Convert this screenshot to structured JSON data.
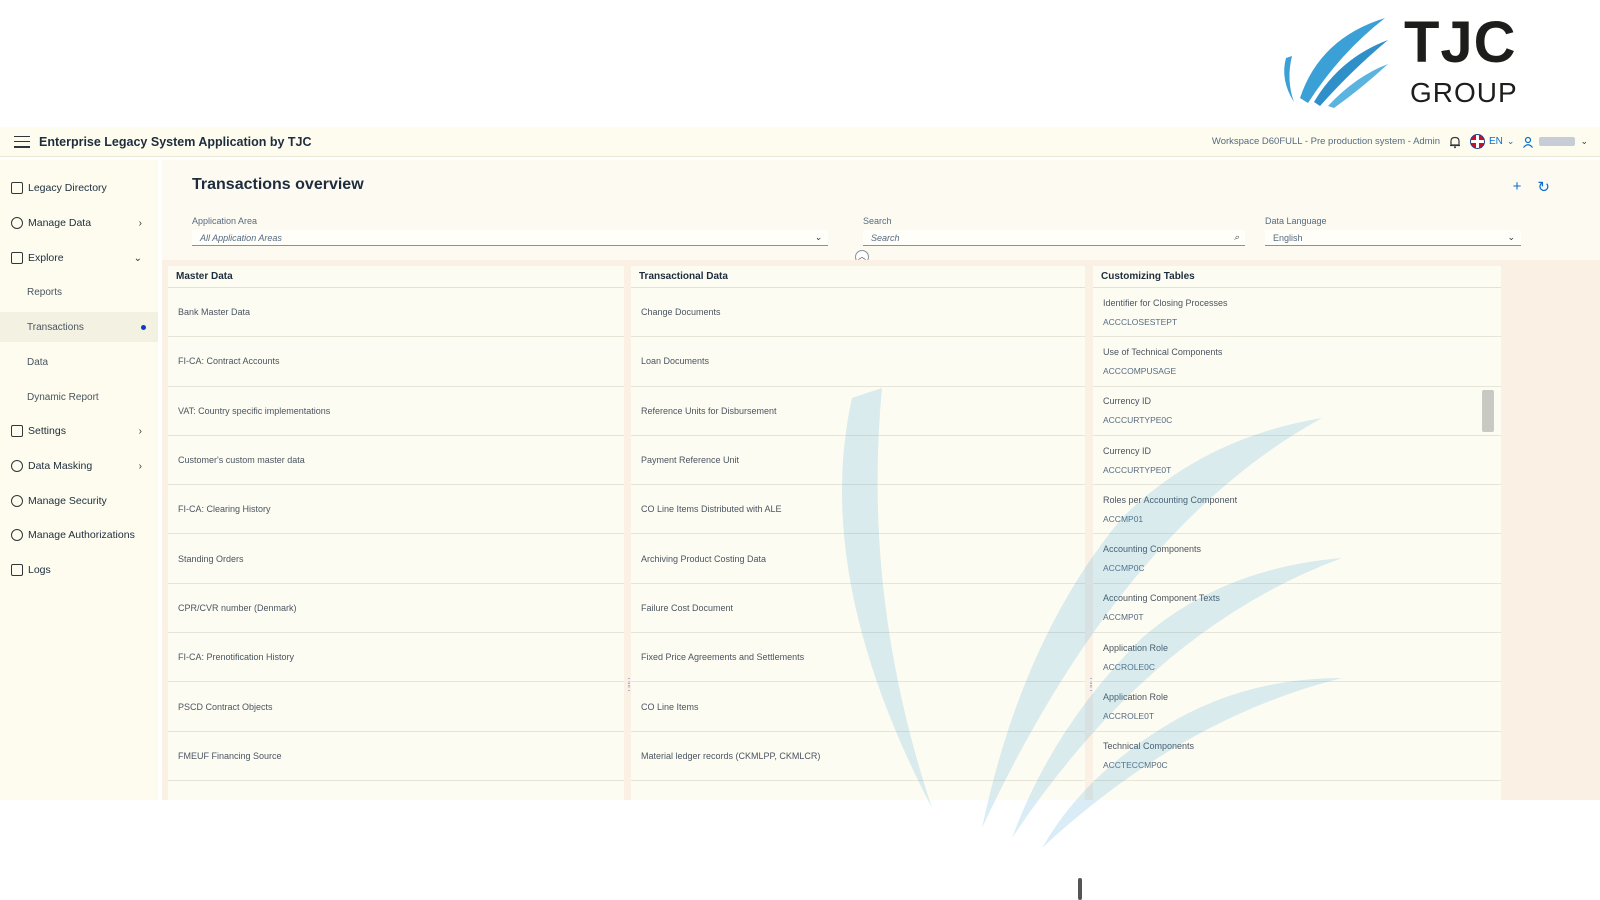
{
  "brand": {
    "name": "TJC",
    "sub": "GROUP",
    "colors": {
      "mark": "#3aa0d6",
      "text": "#1d1d1b"
    }
  },
  "shell": {
    "title": "Enterprise Legacy System Application by TJC",
    "workspace": "Workspace D60FULL - Pre production system - Admin",
    "language": "EN",
    "icons": {
      "menu": "hamburger-icon",
      "notifications": "bell-icon",
      "language": "flag-uk-icon",
      "user": "user-icon"
    }
  },
  "sidebar": {
    "items": [
      {
        "label": "Legacy Directory",
        "icon": "directory-icon"
      },
      {
        "label": "Manage Data",
        "icon": "cloud-icon",
        "arrow": "›"
      },
      {
        "label": "Explore",
        "icon": "explore-icon",
        "arrow": "⌄"
      },
      {
        "label": "Reports"
      },
      {
        "label": "Transactions"
      },
      {
        "label": "Data"
      },
      {
        "label": "Dynamic Report"
      },
      {
        "label": "Settings",
        "icon": "settings-icon",
        "arrow": "›"
      },
      {
        "label": "Data Masking",
        "icon": "masking-icon",
        "arrow": "›"
      },
      {
        "label": "Manage Security",
        "icon": "shield-icon"
      },
      {
        "label": "Manage Authorizations",
        "icon": "authorizations-icon"
      },
      {
        "label": "Logs",
        "icon": "logs-icon"
      }
    ],
    "selected": "Transactions"
  },
  "page": {
    "title": "Transactions overview",
    "actions": {
      "add": "+",
      "refresh": "↻"
    }
  },
  "filters": {
    "app_area_label": "Application Area",
    "app_area_value": "All Application Areas",
    "search_label": "Search",
    "search_placeholder": "Search",
    "data_lang_label": "Data Language",
    "data_lang_value": "English"
  },
  "columns": {
    "master": {
      "header": "Master Data",
      "rows": [
        "Bank Master Data",
        "FI-CA: Contract Accounts",
        "VAT: Country specific implementations",
        "Customer's custom master data",
        "FI-CA: Clearing History",
        "Standing Orders",
        "CPR/CVR number (Denmark)",
        "FI-CA: Prenotification History",
        "PSCD Contract Objects",
        "FMEUF Financing Source"
      ]
    },
    "transactional": {
      "header": "Transactional Data",
      "rows": [
        "Change Documents",
        "Loan Documents",
        "Reference Units for Disbursement",
        "Payment Reference Unit",
        "CO Line Items Distributed with ALE",
        "Archiving Product Costing Data",
        "Failure Cost Document",
        "Fixed Price Agreements and Settlements",
        "CO Line Items",
        "Material ledger records (CKMLPP, CKMLCR)"
      ]
    },
    "customizing": {
      "header": "Customizing Tables",
      "rows": [
        {
          "title": "Identifier for Closing Processes",
          "code": "ACCCLOSESTEPT"
        },
        {
          "title": "Use of Technical Components",
          "code": "ACCCOMPUSAGE"
        },
        {
          "title": "Currency ID",
          "code": "ACCCURTYPE0C"
        },
        {
          "title": "Currency ID",
          "code": "ACCCURTYPE0T"
        },
        {
          "title": "Roles per Accounting Component",
          "code": "ACCMP01"
        },
        {
          "title": "Accounting Components",
          "code": "ACCMP0C"
        },
        {
          "title": "Accounting Component Texts",
          "code": "ACCMP0T"
        },
        {
          "title": "Application Role",
          "code": "ACCROLE0C"
        },
        {
          "title": "Application Role",
          "code": "ACCROLE0T"
        },
        {
          "title": "Technical Components",
          "code": "ACCTECCMP0C"
        }
      ]
    }
  }
}
